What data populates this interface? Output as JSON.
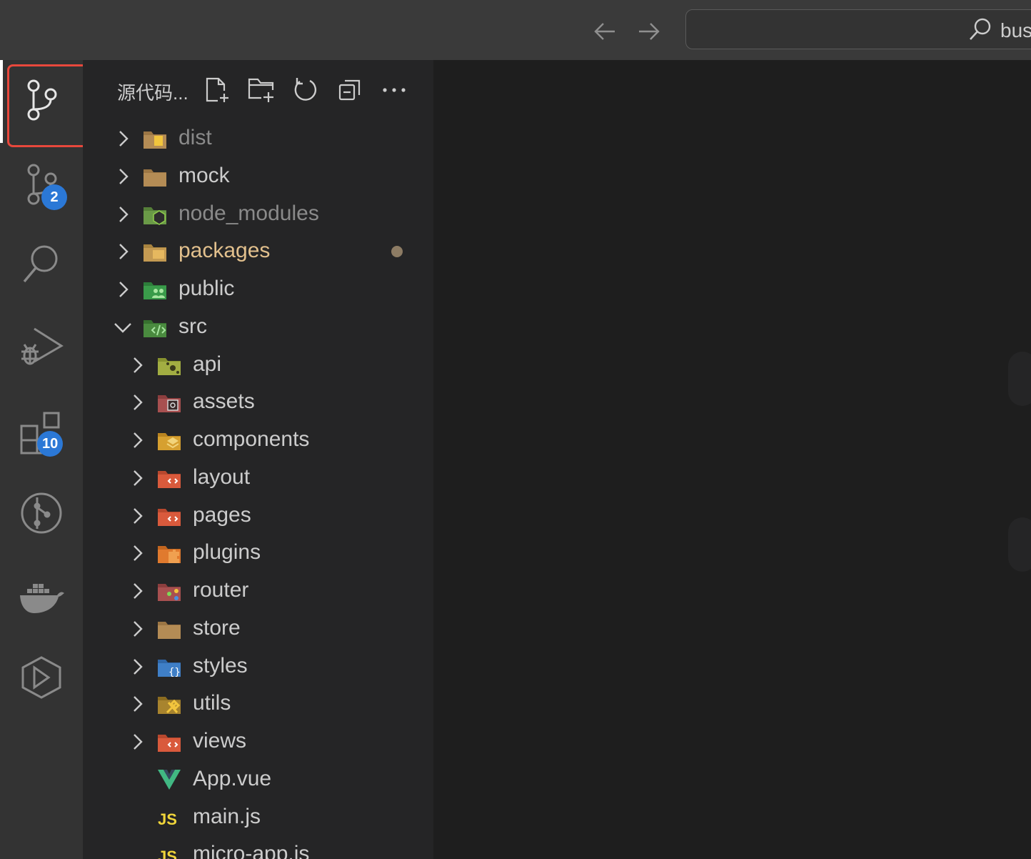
{
  "titlebar": {
    "search_text": "bus"
  },
  "activity": {
    "scm_badge": "2",
    "extensions_badge": "10"
  },
  "sidebar": {
    "title": "源代码...",
    "items": [
      {
        "label": "dist",
        "depth": 0,
        "expanded": false,
        "icon": "folder-dist-icon",
        "color": "#8a8a8a"
      },
      {
        "label": "mock",
        "depth": 0,
        "expanded": false,
        "icon": "folder-icon",
        "color": "#cccccc"
      },
      {
        "label": "node_modules",
        "depth": 0,
        "expanded": false,
        "icon": "folder-node-icon",
        "color": "#8a8a8a"
      },
      {
        "label": "packages",
        "depth": 0,
        "expanded": false,
        "icon": "folder-packages-icon",
        "color": "#e2c08d",
        "modified": true
      },
      {
        "label": "public",
        "depth": 0,
        "expanded": false,
        "icon": "folder-public-icon",
        "color": "#cccccc"
      },
      {
        "label": "src",
        "depth": 0,
        "expanded": true,
        "icon": "folder-src-icon",
        "color": "#cccccc"
      },
      {
        "label": "api",
        "depth": 1,
        "expanded": false,
        "icon": "folder-api-icon",
        "color": "#cccccc"
      },
      {
        "label": "assets",
        "depth": 1,
        "expanded": false,
        "icon": "folder-assets-icon",
        "color": "#cccccc"
      },
      {
        "label": "components",
        "depth": 1,
        "expanded": false,
        "icon": "folder-components-icon",
        "color": "#cccccc"
      },
      {
        "label": "layout",
        "depth": 1,
        "expanded": false,
        "icon": "folder-layout-icon",
        "color": "#cccccc"
      },
      {
        "label": "pages",
        "depth": 1,
        "expanded": false,
        "icon": "folder-pages-icon",
        "color": "#cccccc"
      },
      {
        "label": "plugins",
        "depth": 1,
        "expanded": false,
        "icon": "folder-plugins-icon",
        "color": "#cccccc"
      },
      {
        "label": "router",
        "depth": 1,
        "expanded": false,
        "icon": "folder-router-icon",
        "color": "#cccccc"
      },
      {
        "label": "store",
        "depth": 1,
        "expanded": false,
        "icon": "folder-icon",
        "color": "#cccccc"
      },
      {
        "label": "styles",
        "depth": 1,
        "expanded": false,
        "icon": "folder-styles-icon",
        "color": "#cccccc"
      },
      {
        "label": "utils",
        "depth": 1,
        "expanded": false,
        "icon": "folder-utils-icon",
        "color": "#cccccc"
      },
      {
        "label": "views",
        "depth": 1,
        "expanded": false,
        "icon": "folder-views-icon",
        "color": "#cccccc"
      },
      {
        "label": "App.vue",
        "depth": 1,
        "file": true,
        "icon": "vue-file-icon",
        "color": "#cccccc"
      },
      {
        "label": "main.js",
        "depth": 1,
        "file": true,
        "icon": "js-file-icon",
        "color": "#cccccc"
      },
      {
        "label": "micro-app.js",
        "depth": 1,
        "file": true,
        "icon": "js-file-icon",
        "color": "#cccccc"
      }
    ]
  }
}
